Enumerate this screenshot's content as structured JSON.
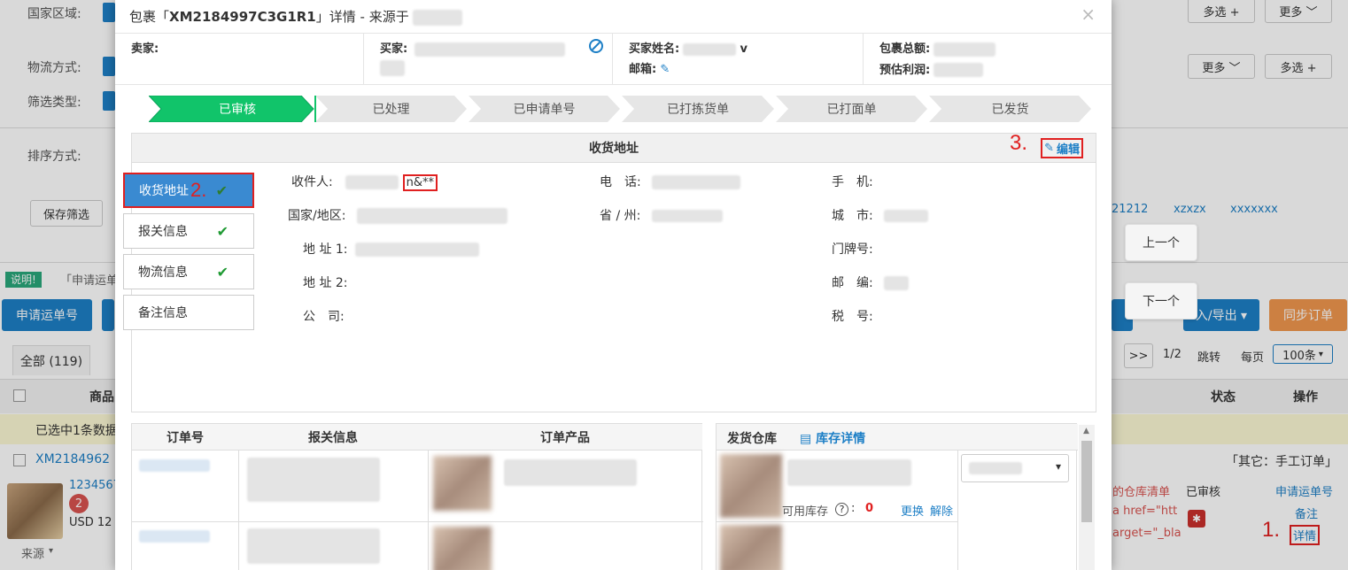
{
  "background": {
    "filters": {
      "region_label": "国家区域:",
      "logistics_label": "物流方式:",
      "filter_type_label": "筛选类型:",
      "sort_label": "排序方式:",
      "save_filter": "保存筛选",
      "multi_select": "多选 +",
      "more": "更多 ﹀"
    },
    "tags": [
      "21212",
      "xzxzx",
      "xxxxxxx"
    ],
    "notice": "说明!",
    "notice_text": "「申请运单",
    "apply_waybill_btn": "申请运单号",
    "import_export_btn": "入/导出 ▾",
    "sync_btn": "同步订单",
    "tab_all": "全部 (119)",
    "pager": {
      "next": ">>",
      "page": "1/2",
      "jump": "跳转",
      "per_page_label": "每页",
      "per_page_value": "100条"
    },
    "columns": {
      "product": "商品",
      "status": "状态",
      "action": "操作"
    },
    "selected_notice": "已选中1条数据",
    "order_id": "XM2184962",
    "other_tag": "「其它：手工订单」",
    "item_num": "1234567",
    "badge": "2",
    "price": "USD 12",
    "source": "来源",
    "warehouse_list": "的仓库清单",
    "html_snippet_1": "a href=\"htt",
    "html_snippet_2": "arget=\"_bla",
    "status_text": "已审核",
    "actions": {
      "apply": "申请运单号",
      "note": "备注",
      "detail": "详情"
    },
    "annotation_1": "1."
  },
  "modal": {
    "title_prefix": "包裹「",
    "title_id": "XM2184997C3G1R1",
    "title_suffix": "」详情 - 来源于",
    "close": "×",
    "info": {
      "seller_label": "卖家:",
      "buyer_label": "买家:",
      "buyer_name_label": "买家姓名:",
      "buyer_name_tail": "v",
      "email_label": "邮箱:",
      "total_label": "包裹总额:",
      "profit_label": "预估利润:"
    },
    "steps": [
      "已审核",
      "已处理",
      "已申请单号",
      "已打拣货单",
      "已打面单",
      "已发货"
    ],
    "address": {
      "header": "收货地址",
      "edit": "编辑",
      "annotation_3": "3.",
      "annotation_2": "2.",
      "tabs": [
        {
          "label": "收货地址",
          "check": "✔"
        },
        {
          "label": "报关信息",
          "check": "✔"
        },
        {
          "label": "物流信息",
          "check": "✔"
        },
        {
          "label": "备注信息",
          "check": ""
        }
      ],
      "fields": {
        "recipient": "收件人:",
        "recipient_value": "n&**",
        "phone": "电　话:",
        "mobile": "手　机:",
        "country": "国家/地区:",
        "province": "省 / 州:",
        "city": "城　市:",
        "addr1": "地 址 1:",
        "door": "门牌号:",
        "addr2": "地 址 2:",
        "zip": "邮　编:",
        "company": "公　司:",
        "tax": "税　号:"
      }
    },
    "orders_table": {
      "col_order": "订单号",
      "col_customs": "报关信息",
      "col_product": "订单产品"
    },
    "warehouse_table": {
      "col_warehouse": "发货仓库",
      "stock_detail": "库存详情",
      "available_stock": "可用库存",
      "stock_value": "0",
      "replace": "更换",
      "unbind": "解除"
    }
  },
  "nav": {
    "prev": "上一个",
    "next": "下一个"
  }
}
